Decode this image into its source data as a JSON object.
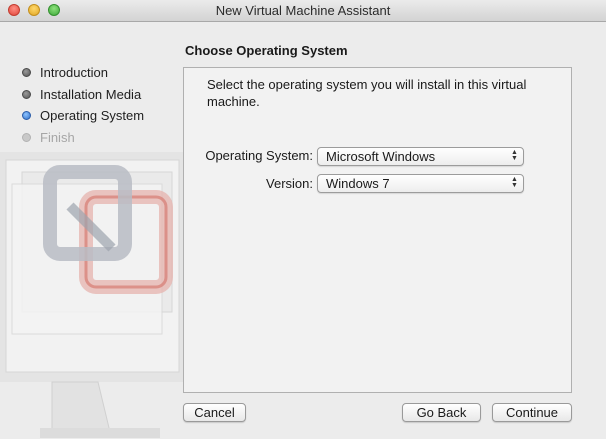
{
  "window": {
    "title": "New Virtual Machine Assistant"
  },
  "sidebar": {
    "steps": [
      {
        "label": "Introduction",
        "state": "done"
      },
      {
        "label": "Installation Media",
        "state": "done"
      },
      {
        "label": "Operating System",
        "state": "current"
      },
      {
        "label": "Finish",
        "state": "future"
      }
    ]
  },
  "main": {
    "heading": "Choose Operating System",
    "description": "Select the operating system you will install in this virtual machine.",
    "os_label": "Operating System:",
    "os_value": "Microsoft Windows",
    "version_label": "Version:",
    "version_value": "Windows 7"
  },
  "buttons": {
    "cancel": "Cancel",
    "go_back": "Go Back",
    "continue": "Continue"
  },
  "icons": {
    "close": "close-icon",
    "minimize": "minimize-icon",
    "zoom": "zoom-icon",
    "popup_arrows": "up-down-arrows-icon",
    "watermark": "vmware-fusion-logo-icon"
  },
  "colors": {
    "current_step": "#2f6fc8",
    "future_step": "#a6a6a6"
  }
}
